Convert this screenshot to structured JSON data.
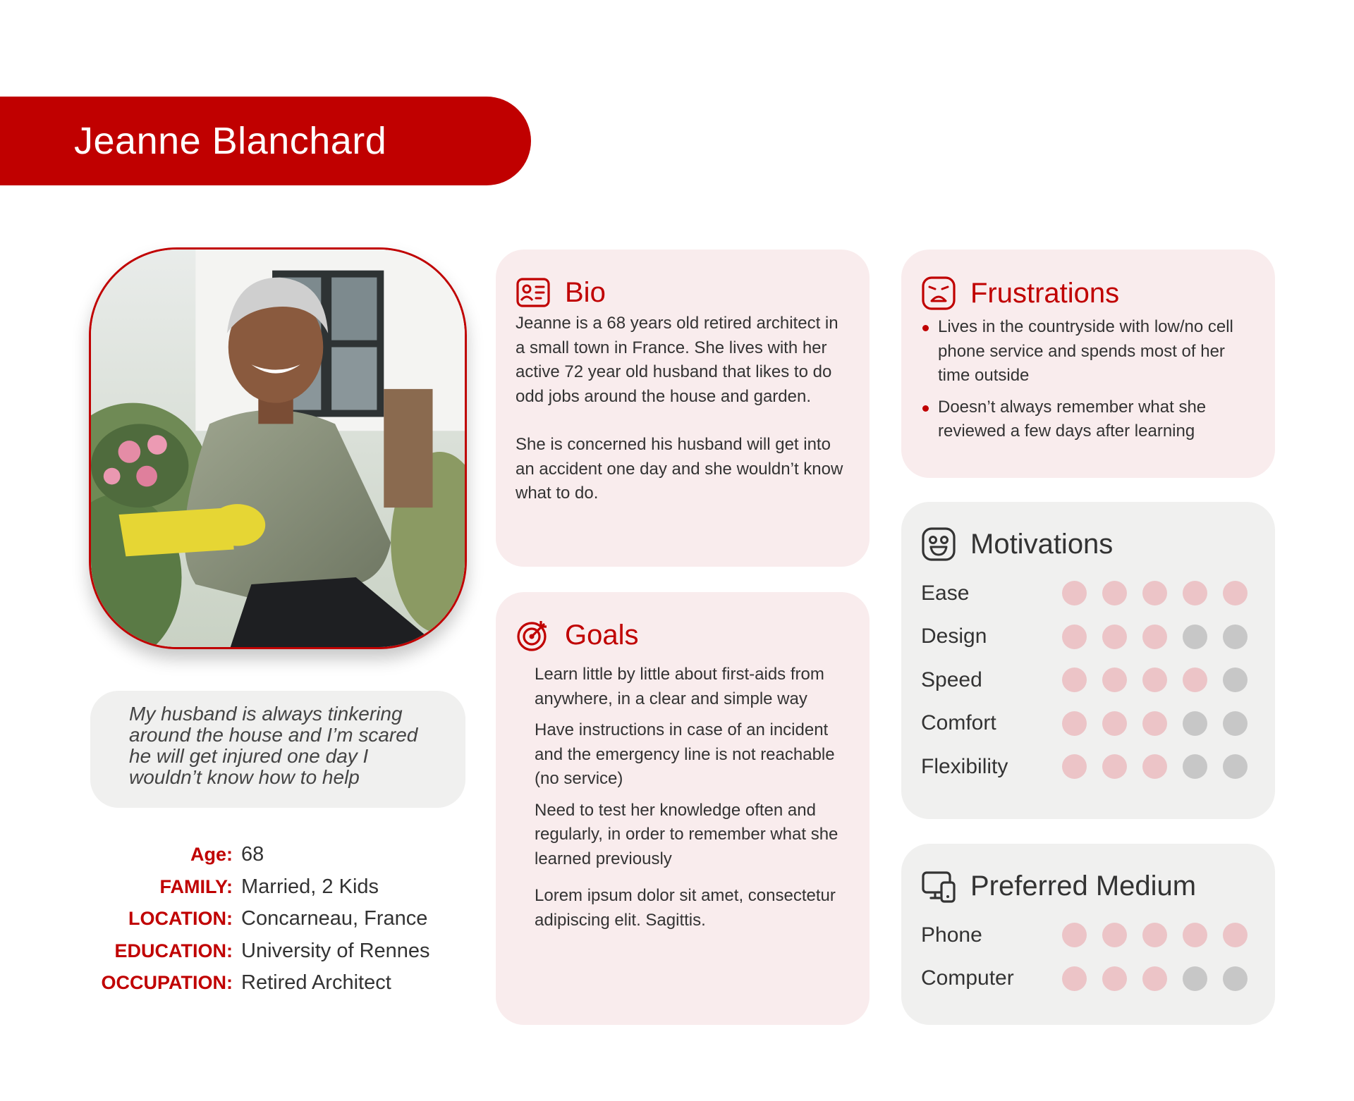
{
  "name": "Jeanne Blanchard",
  "quote": "My husband is always tinkering around the house and I’m scared he will get injured one day I wouldn’t know how to help",
  "facts": [
    {
      "label": "Age:",
      "value": "68"
    },
    {
      "label": "FAMILY:",
      "value": "Married, 2 Kids"
    },
    {
      "label": "LOCATION:",
      "value": "Concarneau, France"
    },
    {
      "label": "EDUCATION:",
      "value": "University of Rennes"
    },
    {
      "label": "OCCUPATION:",
      "value": "Retired Architect"
    }
  ],
  "bio": {
    "title": "Bio",
    "icon": "id-card-icon",
    "paragraphs": [
      "Jeanne is a 68 years old retired architect in a small town in France. She lives with her active 72 year old husband that likes to do odd jobs around the house and garden.",
      "She is concerned his husband will get into an accident one day and she wouldn’t know what to do."
    ]
  },
  "goals": {
    "title": "Goals",
    "icon": "target-icon",
    "items": [
      "Learn little by little about first-aids from anywhere, in a clear and simple way",
      "Have instructions in case of an incident and the emergency line is not reachable (no service)",
      "Need to test her knowledge often and regularly, in order to remember what she learned previously"
    ],
    "lorem": "Lorem ipsum dolor sit amet, consectetur adipiscing elit. Sagittis."
  },
  "frustrations": {
    "title": "Frustrations",
    "icon": "frustrated-face-icon",
    "items": [
      "Lives in the countryside with low/no cell phone service and spends most of her time outside",
      "Doesn’t always remember what she reviewed a few days after learning"
    ]
  },
  "motivations": {
    "title": "Motivations",
    "icon": "happy-face-icon",
    "max": 5,
    "items": [
      {
        "label": "Ease",
        "value": 5
      },
      {
        "label": "Design",
        "value": 3
      },
      {
        "label": "Speed",
        "value": 4
      },
      {
        "label": "Comfort",
        "value": 3
      },
      {
        "label": "Flexibility",
        "value": 3
      }
    ]
  },
  "preferred_medium": {
    "title": "Preferred Medium",
    "icon": "devices-icon",
    "max": 5,
    "items": [
      {
        "label": "Phone",
        "value": 5
      },
      {
        "label": "Computer",
        "value": 3
      }
    ]
  },
  "colors": {
    "accent": "#c00000",
    "dot_on": "#ecc4c7",
    "dot_off": "#c7c7c7",
    "card_pink": "#f9eced",
    "card_gray": "#f0f0ef"
  }
}
